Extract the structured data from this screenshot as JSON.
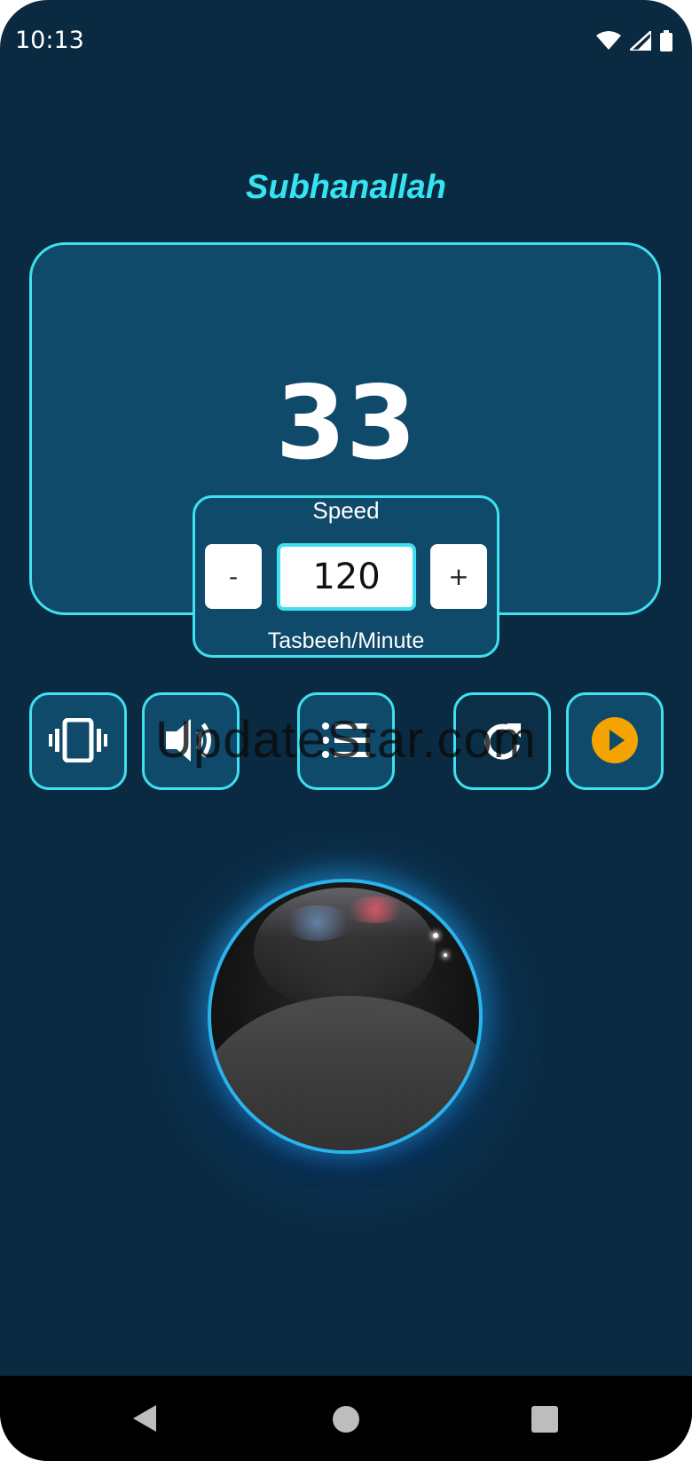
{
  "status_bar": {
    "time": "10:13",
    "icons": [
      "wifi-icon",
      "cell-signal-icon",
      "battery-icon"
    ]
  },
  "title": "Subhanallah",
  "counter": {
    "value": "33"
  },
  "speed": {
    "label": "Speed",
    "value": "120",
    "unit": "Tasbeeh/Minute",
    "minus_label": "-",
    "plus_label": "+"
  },
  "controls": [
    {
      "icon": "vibrate-icon"
    },
    {
      "icon": "sound-icon"
    },
    {
      "icon": "list-icon"
    },
    {
      "icon": "reset-icon"
    },
    {
      "icon": "play-icon"
    }
  ],
  "watermark": "UpdateStar.com",
  "colors": {
    "background": "#0a2a42",
    "panel": "#0f4a6b",
    "accent": "#3fe0ef",
    "title": "#35e4f3",
    "play": "#f5a300",
    "ring": "#2ab4ec"
  },
  "nav_bar": {
    "icons": [
      "back-icon",
      "home-icon",
      "recents-icon"
    ]
  }
}
